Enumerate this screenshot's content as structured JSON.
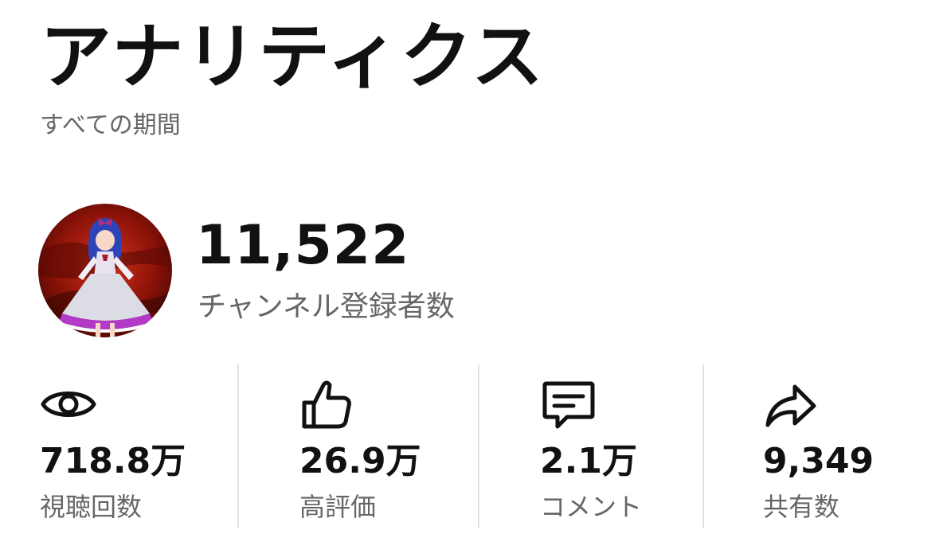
{
  "header": {
    "title": "アナリティクス",
    "period": "すべての期間"
  },
  "channel": {
    "avatar_icon": "channel-avatar",
    "subscriber_count": "11,522",
    "subscriber_label": "チャンネル登録者数"
  },
  "stats": [
    {
      "icon": "eye-icon",
      "value": "718.8万",
      "label": "視聴回数"
    },
    {
      "icon": "thumbs-up-icon",
      "value": "26.9万",
      "label": "高評価"
    },
    {
      "icon": "comment-icon",
      "value": "2.1万",
      "label": "コメント"
    },
    {
      "icon": "share-icon",
      "value": "9,349",
      "label": "共有数"
    }
  ],
  "colors": {
    "text_primary": "#111111",
    "text_secondary": "#666666",
    "divider": "#e2e2e2"
  }
}
